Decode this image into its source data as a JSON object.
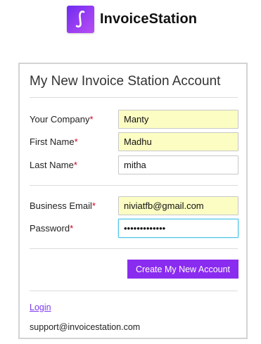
{
  "brand": {
    "name": "InvoiceStation",
    "logo_glyph": "ʃ"
  },
  "form": {
    "title": "My New Invoice Station Account",
    "required_marker": "*",
    "fields": {
      "company": {
        "label": "Your Company",
        "value": "Manty"
      },
      "first_name": {
        "label": "First Name",
        "value": "Madhu"
      },
      "last_name": {
        "label": "Last Name",
        "value": "mitha"
      },
      "email": {
        "label": "Business Email",
        "value": "niviatfb@gmail.com"
      },
      "password": {
        "label": "Password",
        "value": "•••••••••••••"
      }
    },
    "submit_label": "Create My New Account",
    "login_link": "Login",
    "support_email": "support@invoicestation.com"
  },
  "colors": {
    "accent": "#8a2cf0",
    "autofill": "#fbfdc2",
    "required": "#d0021b",
    "focus": "#4fc3e6"
  }
}
